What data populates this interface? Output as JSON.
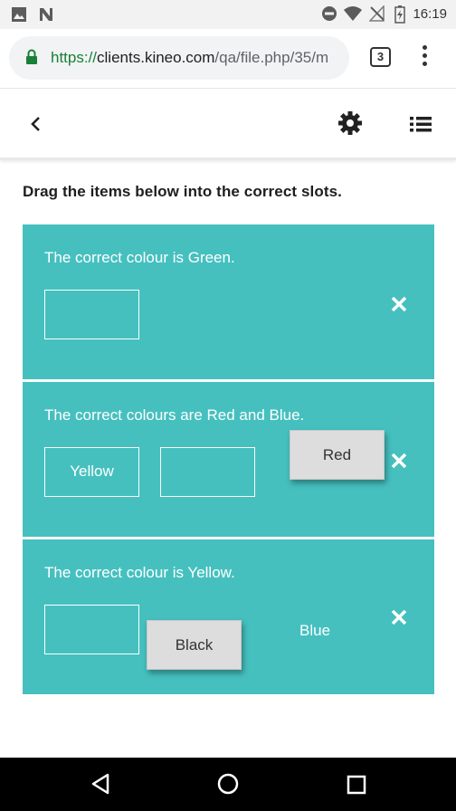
{
  "status_bar": {
    "time": "16:19",
    "icons": [
      "image-icon",
      "n-notification-icon",
      "do-not-disturb-icon",
      "wifi-icon",
      "no-signal-icon",
      "battery-charging-icon"
    ]
  },
  "browser": {
    "url_scheme": "https://",
    "url_host": "clients.kineo.com",
    "url_path": "/qa/file.php/35/m",
    "tab_count": "3"
  },
  "header": {
    "icons": [
      "back-icon",
      "settings-icon",
      "menu-list-icon"
    ]
  },
  "instruction": "Drag the items below into the correct slots.",
  "questions": [
    {
      "text": "The correct colour is Green."
    },
    {
      "text": "The correct colours are Red and Blue.",
      "slot_1_value": "Yellow"
    },
    {
      "text": "The correct colour is Yellow."
    }
  ],
  "drag_items": {
    "red": "Red",
    "black": "Black",
    "blue": "Blue"
  },
  "colors": {
    "question_background": "#45c0bf",
    "drag_item_background": "#dddddd"
  }
}
